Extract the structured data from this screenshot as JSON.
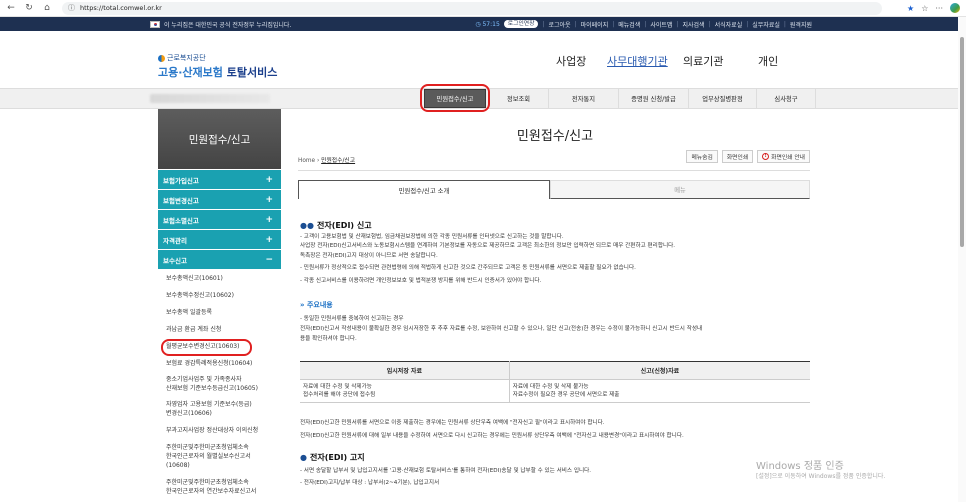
{
  "browser": {
    "url": "https://total.comwel.or.kr"
  },
  "gov_bar": {
    "notice": "이 누리집은 대한민국 공식 전자정부 누리집입니다.",
    "timer": "◷ 57:15",
    "login_extend": "로그인연장",
    "links": [
      "로그아웃",
      "마이페이지",
      "메뉴검색",
      "사이트맵",
      "지사검색",
      "서식자료실",
      "실무자료실",
      "원격지원"
    ]
  },
  "header": {
    "logo_small": "근로복지공단",
    "logo_big_a": "고용·산재보험",
    "logo_big_b": " 토탈서비스",
    "nav": [
      "사업장",
      "사무대행기관",
      "의료기관",
      "개인"
    ]
  },
  "gnb": {
    "items": [
      "민원접수/신고",
      "정보조회",
      "전자통지",
      "증명원 신청/발급",
      "업무상질병판정",
      "심사청구"
    ]
  },
  "sidebar": {
    "title": "민원접수/신고",
    "menus": [
      "보험가입신고",
      "보험변경신고",
      "보험소멸신고",
      "자격관리",
      "보수신고"
    ],
    "subs": [
      "보수총액신고(10601)",
      "보수총액수정신고(10602)",
      "보수총액 일괄등록",
      "과납금 환급 계좌 신청",
      "월평균보수변경신고(10603)",
      "보험료 경감특례적용신청(10604)",
      "중소기업사업주 및 가족종사자",
      "산재보험 기준보수등급신고(10605)",
      "자영업자 고용보험 기준보수(등급)",
      "변경신고(10606)",
      "부과고지사업장 정산대상자 이의신청",
      "주한미군및주한미군초청업체소속",
      "한국인근로자의 월별실보수신고서",
      "(10608)",
      "주한미군및주한미군초청업체소속",
      "한국인근로자의 연간보수자료신고서"
    ]
  },
  "main": {
    "title": "민원접수/신고",
    "breadcrumb_home": "Home",
    "breadcrumb_current": "민원접수/신고",
    "tools": [
      "메뉴숨김",
      "화면인쇄",
      "화면인쇄 안내"
    ],
    "tab_on": "민원접수/신고 소개",
    "tab_off": "메뉴",
    "section1_title": "전자(EDI) 신고",
    "section1_lines": [
      "- 고객이 고용보험법 및 산재보험법, 임금채권보장법에 의한 각종 민원서류를 인터넷으로 신고하는 것을 말합니다.",
      "  사업장 전자(EDI)신고서비스와 노동보험시스템을 연계하여 기본정보를 자동으로 제공하므로 고객은 최소한의 정보만 입력하면 되므로 매우 간편하고 편리합니다.",
      "  독촉장은 전자(EDI)고지 대상이 아니므로 서면 송달합니다.",
      "- 민원서류가 정상적으로 접수되면 관련법령에 의해 적법하게 신고한 것으로 간주되므로 고객은 동 민원서류를 서면으로 제출할 필요가 없습니다.",
      "- 각종 신고서비스를 이용하려면 개인정보보호 및 법적분쟁 방지를 위해 반드시 인증서가 있어야 합니다."
    ],
    "subsection_title": "주요내용",
    "subsection_lines": [
      "- 동일한 민원서류를 중복하여 신고하는 경우",
      "  전자(EDI)신고서 작성내용이 불확실한 경우 임시저장한 후 추후 자료를 수정, 보완하여 신고할 수 있으나, 일단 신고(전송)한 경우는 수정이 불가능하니 신고시 반드시 작성내",
      "  용을 확인하셔야 합니다."
    ],
    "table": {
      "headers": [
        "임시저장 자료",
        "신고(신청)자료"
      ],
      "rows": [
        [
          "자료에 대한 수정 및 삭제가능",
          "자료에 대한 수정 및 삭제 불가능"
        ],
        [
          "접수처리를 해야 공단에 접수됨",
          "자료수정이 필요한 경우 공단에 서면으로 제출"
        ]
      ]
    },
    "after_table_lines": [
      "전자(EDI)신고한 민원서류를 서면으로 이중 제출하는 경우에는 민원서류 상단우측 여백에 \"전자신고 필\"이라고 표시하여야 합니다.",
      "전자(EDI)신고한 민원서류에 대해 일부 내용을 수정하여 서면으로 다시 신고하는 경우에는 민원서류 상단우측 여백에 \"전자신고 내용변경\"이라고 표시하여야 합니다."
    ],
    "section2_title": "전자(EDI) 고지",
    "section2_lines": [
      "- 서면 송달할 납부서 및 납입고지서를 '고용·산재보험 토탈서비스'를 통하여 전자(EDI)송달 및 납부할 수 있는 서비스 입니다.",
      "- 전자(EDI)고지/납부 대상 : 납부서(2~4기분), 납입고지서"
    ]
  },
  "watermark": {
    "line1": "Windows 정품 인증",
    "line2": "[설정]으로 이동하여 Windows를 정품 인증합니다."
  }
}
